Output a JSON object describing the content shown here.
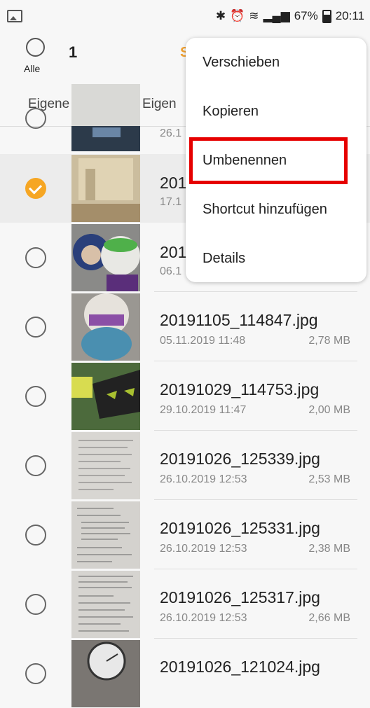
{
  "status": {
    "battery": "67%",
    "time": "20:11"
  },
  "selection": {
    "count": "1",
    "all_label": "Alle",
    "partial_label": "S"
  },
  "breadcrumb": {
    "first": "Eigene Dateien",
    "second": "Eigen"
  },
  "files": [
    {
      "name": "",
      "date": "26.1",
      "size": ""
    },
    {
      "name": "201",
      "date": "17.1",
      "size": "",
      "selected": true
    },
    {
      "name": "201",
      "date": "06.1",
      "size": ""
    },
    {
      "name": "20191105_114847.jpg",
      "date": "05.11.2019 11:48",
      "size": "2,78 MB"
    },
    {
      "name": "20191029_114753.jpg",
      "date": "29.10.2019 11:47",
      "size": "2,00 MB"
    },
    {
      "name": "20191026_125339.jpg",
      "date": "26.10.2019 12:53",
      "size": "2,53 MB"
    },
    {
      "name": "20191026_125331.jpg",
      "date": "26.10.2019 12:53",
      "size": "2,38 MB"
    },
    {
      "name": "20191026_125317.jpg",
      "date": "26.10.2019 12:53",
      "size": "2,66 MB"
    },
    {
      "name": "20191026_121024.jpg",
      "date": "",
      "size": ""
    }
  ],
  "menu": {
    "items": [
      "Verschieben",
      "Kopieren",
      "Umbenennen",
      "Shortcut hinzufügen",
      "Details"
    ],
    "highlight_color": "#e60000"
  },
  "colors": {
    "accent": "#f6a623"
  }
}
